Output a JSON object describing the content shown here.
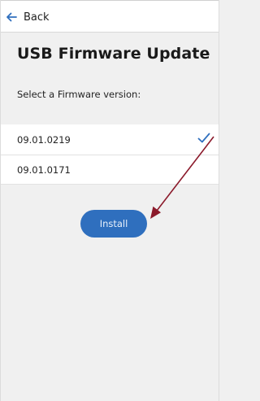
{
  "header": {
    "back_label": "Back"
  },
  "page": {
    "title": "USB Firmware Update",
    "instruction": "Select a Firmware version:"
  },
  "firmware_versions": [
    {
      "label": "09.01.0219",
      "selected": true
    },
    {
      "label": "09.01.0171",
      "selected": false
    }
  ],
  "actions": {
    "install_label": "Install"
  },
  "colors": {
    "accent": "#2f6fbe",
    "check": "#2f6fbe",
    "annotation_arrow": "#8b1a2b",
    "background": "#f0f0f0"
  },
  "icons": {
    "back": "arrow-left-icon",
    "selected": "checkmark-icon"
  }
}
